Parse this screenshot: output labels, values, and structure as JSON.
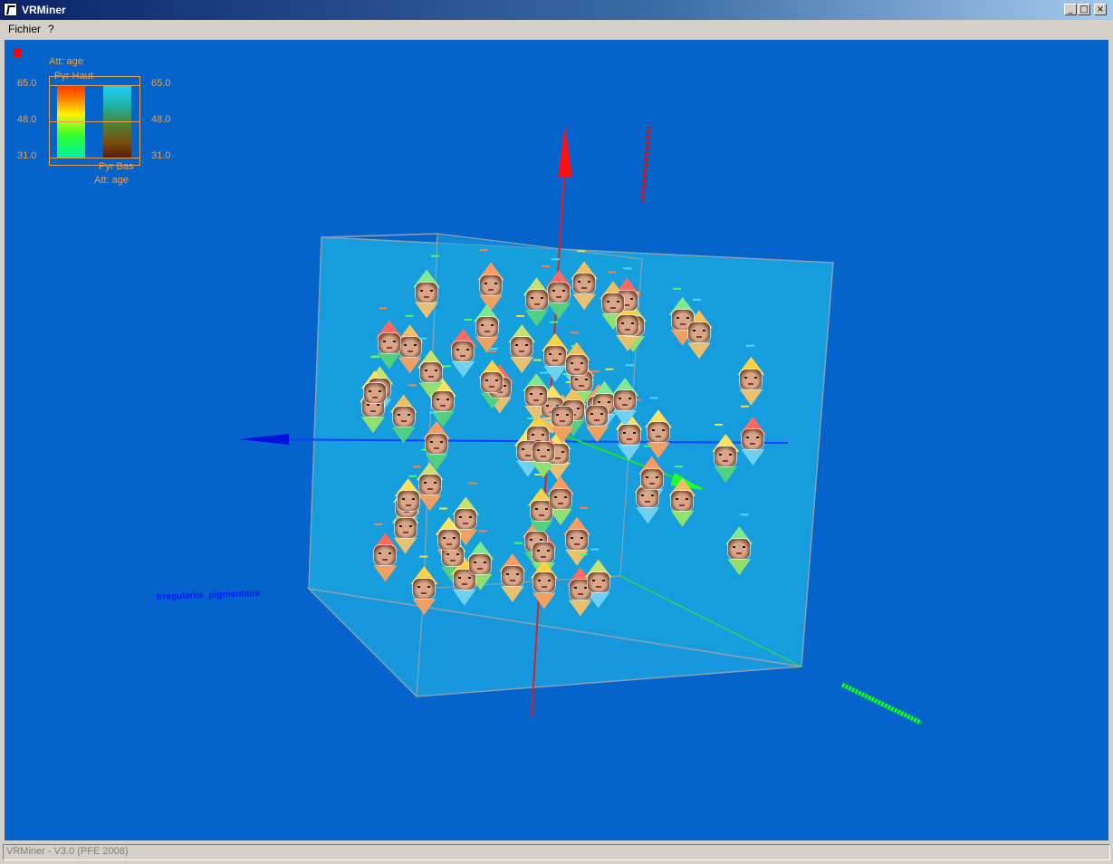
{
  "window": {
    "title": "VRMiner",
    "minimize_symbol": "_",
    "maximize_symbol": "□",
    "close_symbol": "×"
  },
  "menu": [
    "Fichier",
    "?"
  ],
  "legend": {
    "top_attribute": "Att: age",
    "top_label": "Pyr Haut",
    "bottom_label": "Pyr Bas",
    "bottom_attribute": "Att: age",
    "ticks_left": [
      "65.0",
      "48.0",
      "31.0"
    ],
    "ticks_right": [
      "65.0",
      "48.0",
      "31.0"
    ],
    "colors": {
      "line": "#e8a050",
      "indicator": "#ff0000"
    }
  },
  "axes": {
    "x_label": "Irregularite_pigmentaire",
    "y_label": "",
    "z_label": "",
    "colors": {
      "x": "#0000ff",
      "y": "#ff0000",
      "z": "#00ff00"
    }
  },
  "scene": {
    "background": "#0563cc",
    "cube_color": "#1aa7e0",
    "glyph_count": 72
  },
  "status": "VRMiner - V3.0 (PFE 2008)"
}
